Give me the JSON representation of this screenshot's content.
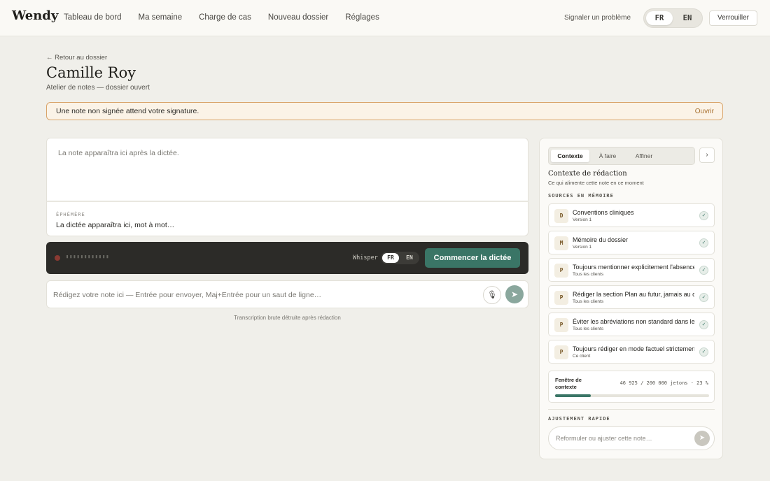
{
  "app": {
    "logo": "Wendy"
  },
  "nav": {
    "items": [
      "Tableau de bord",
      "Ma semaine",
      "Charge de cas",
      "Nouveau dossier",
      "Réglages"
    ],
    "report": "Signaler un problème",
    "lang": {
      "fr": "FR",
      "en": "EN",
      "active": "FR"
    },
    "lock": "Verrouiller"
  },
  "header": {
    "back": "← Retour au dossier",
    "title": "Camille Roy",
    "subtitle": "Atelier de notes — dossier ouvert"
  },
  "banner": {
    "message": "Une note non signée attend votre signature.",
    "action": "Ouvrir"
  },
  "editor": {
    "note_placeholder": "La note apparaîtra ici après la dictée.",
    "ephemeral_label": "ÉPHÉMÈRE",
    "ephemeral_text": "La dictée apparaîtra ici, mot à mot…"
  },
  "dictation": {
    "wave": "▮▮▮▮▮▮▮▮▮▮▮▮",
    "engine": "Whisper",
    "lang": {
      "fr": "FR",
      "en": "EN"
    },
    "start": "Commencer la dictée"
  },
  "compose": {
    "placeholder": "Rédigez votre note ici — Entrée pour envoyer, Maj+Entrée pour un saut de ligne…",
    "mic_icon": "🎙",
    "send_icon": "➤",
    "footer": "Transcription brute détruite après rédaction"
  },
  "panel": {
    "tabs": [
      "Contexte",
      "À faire",
      "Affiner"
    ],
    "active_tab": "Contexte",
    "collapse_icon": "›",
    "title": "Contexte de rédaction",
    "subtitle": "Ce qui alimente cette note en ce moment",
    "sources_label": "SOURCES EN MÉMOIRE",
    "sources": [
      {
        "badge": "D",
        "name": "Conventions cliniques",
        "meta": "Version 1"
      },
      {
        "badge": "M",
        "name": "Mémoire du dossier",
        "meta": "Version 1"
      },
      {
        "badge": "P",
        "name": "Toujours mentionner explicitement l'absence de risque",
        "meta": "Tous les clients"
      },
      {
        "badge": "P",
        "name": "Rédiger la section Plan au futur, jamais au conditionnel",
        "meta": "Tous les clients"
      },
      {
        "badge": "P",
        "name": "Éviter les abréviations non standard dans les notes",
        "meta": "Tous les clients"
      },
      {
        "badge": "P",
        "name": "Toujours rédiger en mode factuel strictement",
        "meta": "Ce client"
      }
    ],
    "context_window": {
      "label": "Fenêtre de contexte",
      "value": "46 925 / 200 000 jetons · 23 %",
      "percent": 23
    },
    "quick_label": "AJUSTEMENT RAPIDE",
    "quick_placeholder": "Reformuler ou ajuster cette note…",
    "quick_send": "➤"
  }
}
